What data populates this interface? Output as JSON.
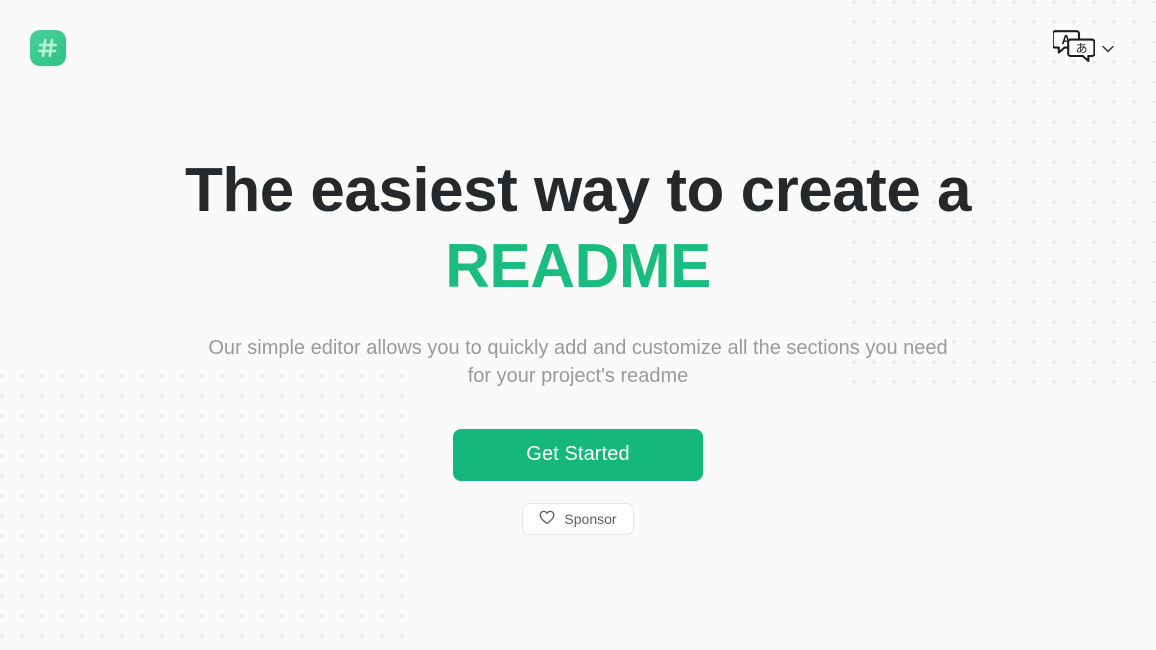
{
  "page": {
    "background_color": "#fafafa",
    "accent_color": "#15b77c",
    "headline_color": "#26292b"
  },
  "header": {
    "logo": {
      "name": "readme-logo",
      "icon": "hash-asterisk-icon",
      "background_color": "#39c98d"
    },
    "language_switcher": {
      "icon": "translate-icon",
      "icon_primary_char": "A",
      "icon_secondary_char": "あ",
      "chevron": "chevron-down-icon"
    }
  },
  "hero": {
    "headline_line1": "The easiest way to create a",
    "headline_line2": "README",
    "subtitle": "Our simple editor allows you to quickly add and customize all the sections you need for your project's readme",
    "primary_button": "Get Started",
    "sponsor_button": {
      "label": "Sponsor",
      "icon": "heart-icon"
    }
  },
  "decoration": {
    "dot_pattern_color": "#e8e8e9",
    "dot_spacing_px": 20
  }
}
